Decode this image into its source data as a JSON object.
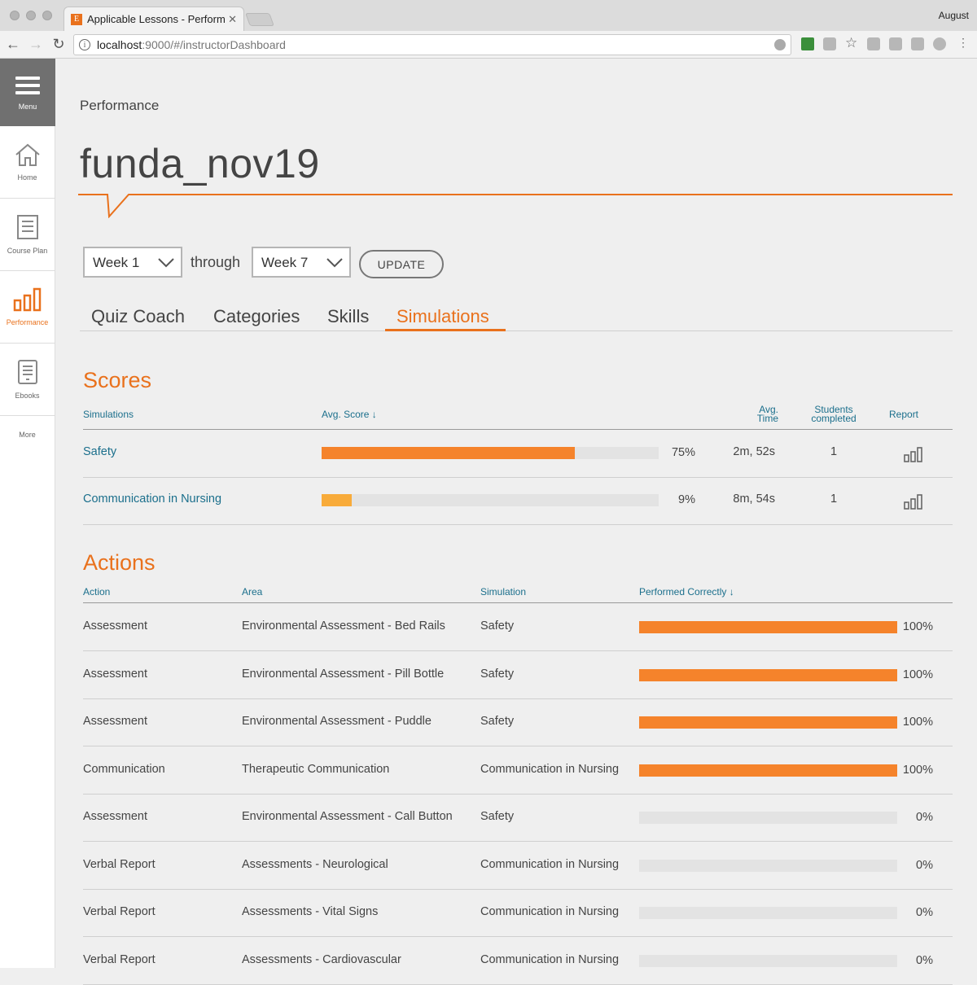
{
  "browser": {
    "tab_title": "Applicable Lessons - Performa",
    "favicon_letter": "E",
    "profile": "August",
    "url_host": "localhost",
    "url_rest": ":9000/#/instructorDashboard"
  },
  "sidebar": {
    "menu_label": "Menu",
    "items": [
      {
        "label": "Home",
        "icon": "home-icon"
      },
      {
        "label": "Course Plan",
        "icon": "list-icon"
      },
      {
        "label": "Performance",
        "icon": "bar-chart-icon"
      },
      {
        "label": "Ebooks",
        "icon": "ebook-icon"
      }
    ],
    "more_label": "More"
  },
  "page": {
    "crumb": "Performance",
    "title": "funda_nov19",
    "from_week": "Week 1",
    "through_label": "through",
    "to_week": "Week 7",
    "update_label": "UPDATE"
  },
  "tabs": [
    "Quiz Coach",
    "Categories",
    "Skills",
    "Simulations"
  ],
  "active_tab": "Simulations",
  "scores": {
    "title": "Scores",
    "headers": {
      "simulations": "Simulations",
      "avg_score": "Avg. Score ↓",
      "avg_time_1": "Avg.",
      "avg_time_2": "Time",
      "students_1": "Students",
      "students_2": "completed",
      "report": "Report"
    },
    "rows": [
      {
        "name": "Safety",
        "score": 75,
        "score_label": "75%",
        "time": "2m, 52s",
        "students": "1",
        "color": "#f5832b"
      },
      {
        "name": "Communication in Nursing",
        "score": 9,
        "score_label": "9%",
        "time": "8m, 54s",
        "students": "1",
        "color": "#f8ab3a"
      }
    ]
  },
  "actions": {
    "title": "Actions",
    "headers": {
      "action": "Action",
      "area": "Area",
      "simulation": "Simulation",
      "performed": "Performed Correctly ↓"
    },
    "rows": [
      {
        "action": "Assessment",
        "area": "Environmental Assessment - Bed Rails",
        "simulation": "Safety",
        "pct": 100,
        "pct_label": "100%"
      },
      {
        "action": "Assessment",
        "area": "Environmental Assessment - Pill Bottle",
        "simulation": "Safety",
        "pct": 100,
        "pct_label": "100%"
      },
      {
        "action": "Assessment",
        "area": "Environmental Assessment - Puddle",
        "simulation": "Safety",
        "pct": 100,
        "pct_label": "100%"
      },
      {
        "action": "Communication",
        "area": "Therapeutic Communication",
        "simulation": "Communication in Nursing",
        "pct": 100,
        "pct_label": "100%"
      },
      {
        "action": "Assessment",
        "area": "Environmental Assessment - Call Button",
        "simulation": "Safety",
        "pct": 0,
        "pct_label": "0%"
      },
      {
        "action": "Verbal Report",
        "area": "Assessments - Neurological",
        "simulation": "Communication in Nursing",
        "pct": 0,
        "pct_label": "0%"
      },
      {
        "action": "Verbal Report",
        "area": "Assessments - Vital Signs",
        "simulation": "Communication in Nursing",
        "pct": 0,
        "pct_label": "0%"
      },
      {
        "action": "Verbal Report",
        "area": "Assessments - Cardiovascular",
        "simulation": "Communication in Nursing",
        "pct": 0,
        "pct_label": "0%"
      }
    ]
  },
  "colors": {
    "accent": "#e9711c",
    "link": "#1b6f8c",
    "bar_fill": "#f5832b",
    "bar_track": "#e3e3e3"
  }
}
